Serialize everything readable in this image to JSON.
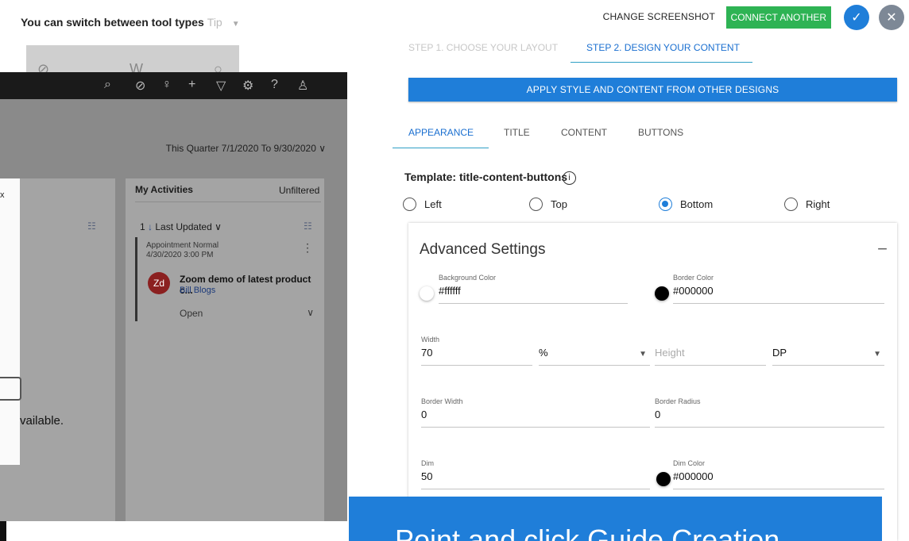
{
  "tip": {
    "text": "You can switch between tool types",
    "tip_label": "Tip"
  },
  "preview": {
    "quarter": "This Quarter 7/1/2020 To 9/30/2020 ∨",
    "available": "vailable.",
    "activities": {
      "title": "My Activities",
      "filter": "Unfiltered",
      "sort": "Last Updated",
      "count": "1",
      "item": {
        "type": "Appointment   Normal",
        "date": "4/30/2020 3:00 PM",
        "initials": "Zd",
        "subject": "Zoom demo of latest product c...",
        "owner": "Bill Blogs",
        "status": "Open"
      }
    }
  },
  "header": {
    "change_screenshot": "CHANGE SCREENSHOT",
    "connect_another": "CONNECT ANOTHER"
  },
  "steps": {
    "step1": "STEP 1. CHOOSE YOUR LAYOUT",
    "step2": "STEP 2. DESIGN YOUR CONTENT"
  },
  "apply_button": "APPLY STYLE AND CONTENT FROM OTHER DESIGNS",
  "tabs": {
    "appearance": "APPEARANCE",
    "title": "TITLE",
    "content": "CONTENT",
    "buttons": "BUTTONS"
  },
  "template": {
    "label": "Template: title-content-buttons",
    "options": {
      "left": "Left",
      "top": "Top",
      "bottom": "Bottom",
      "right": "Right"
    },
    "selected": "Bottom"
  },
  "advanced": {
    "title": "Advanced Settings",
    "background_color": {
      "label": "Background Color",
      "value": "#ffffff"
    },
    "border_color": {
      "label": "Border Color",
      "value": "#000000"
    },
    "width": {
      "label": "Width",
      "value": "70",
      "unit": "%"
    },
    "height": {
      "placeholder": "Height",
      "unit": "DP"
    },
    "border_width": {
      "label": "Border Width",
      "value": "0"
    },
    "border_radius": {
      "label": "Border Radius",
      "value": "0"
    },
    "dim": {
      "label": "Dim",
      "value": "50"
    },
    "dim_color": {
      "label": "Dim Color",
      "value": "#000000"
    }
  },
  "banner": "Point and click Guide Creation",
  "colors": {
    "accent": "#1f7ed9",
    "connect": "#2eb354",
    "close": "#7d8896"
  }
}
